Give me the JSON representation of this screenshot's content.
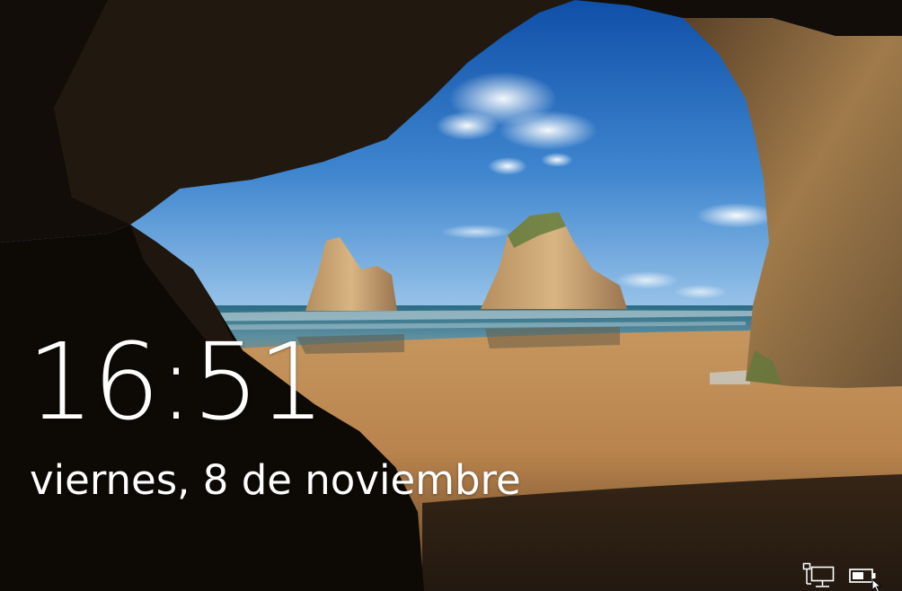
{
  "lockscreen": {
    "time": "16:51",
    "date": "viernes, 8 de noviembre"
  },
  "status_bar": {
    "network_icon": "network-wired-icon",
    "battery_icon": "battery-icon"
  },
  "wallpaper": {
    "subject": "cave-arch-beach-rocks",
    "colors": {
      "sky_top": "#1d5fb6",
      "sky_bottom": "#7fb7e6",
      "sea": "#2f6f86",
      "sand": "#b9854f",
      "rock": "#3a2b1c"
    }
  }
}
